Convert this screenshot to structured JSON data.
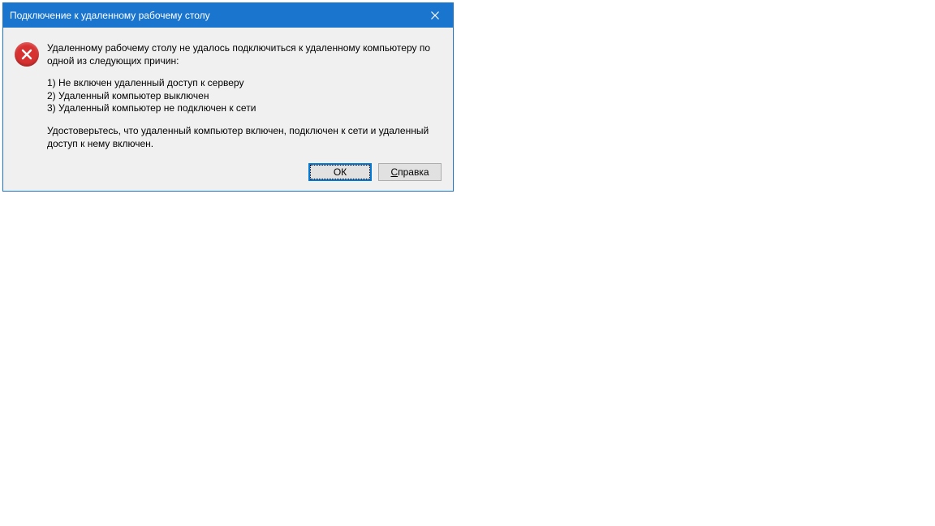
{
  "dialog": {
    "title": "Подключение к удаленному рабочему столу",
    "message_intro": "Удаленному рабочему столу не удалось подключиться к удаленному компьютеру по одной из следующих причин:",
    "reason1": "1) Не включен удаленный доступ к серверу",
    "reason2": "2) Удаленный компьютер выключен",
    "reason3": "3) Удаленный компьютер не подключен к сети",
    "advice": "Удостоверьтесь, что удаленный компьютер включен, подключен к сети и удаленный доступ к нему включен.",
    "ok_label": "ОК",
    "help_mnemonic": "С",
    "help_rest": "правка"
  }
}
